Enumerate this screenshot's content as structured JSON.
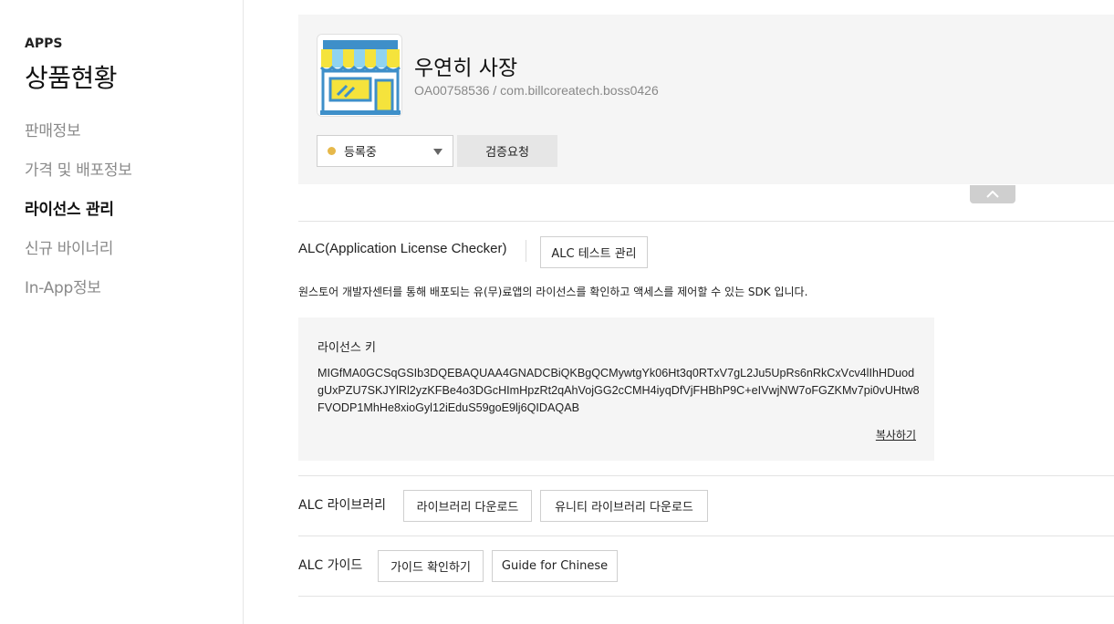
{
  "sidebar": {
    "section": "APPS",
    "title": "상품현황",
    "items": [
      {
        "label": "판매정보",
        "active": false
      },
      {
        "label": "가격 및 배포정보",
        "active": false
      },
      {
        "label": "라이선스 관리",
        "active": true
      },
      {
        "label": "신규 바이너리",
        "active": false
      },
      {
        "label": "In-App정보",
        "active": false
      }
    ]
  },
  "app": {
    "name": "우연히 사장",
    "meta": "OA00758536 / com.billcoreatech.boss0426",
    "icon": "storefront-icon",
    "status": {
      "value": "등록중",
      "dot_color": "#e6b84a"
    },
    "verify_label": "검증요청",
    "collapse_icon": "chevron-up-icon"
  },
  "alc": {
    "title": "ALC(Application License Checker)",
    "test_button": "ALC 테스트 관리",
    "description": "원스토어 개발자센터를 통해 배포되는 유(무)료앱의 라이선스를 확인하고 액세스를 제어할 수 있는 SDK 입니다.",
    "license": {
      "label": "라이선스 키",
      "key": "MIGfMA0GCSqGSIb3DQEBAQUAA4GNADCBiQKBgQCMywtgYk06Ht3q0RTxV7gL2Ju5UpRs6nRkCxVcv4lIhHDuodgUxPZU7SKJYlRl2yzKFBe4o3DGcHImHpzRt2qAhVojGG2cCMH4iyqDfVjFHBhP9C+eIVwjNW7oFGZKMv7pi0vUHtw8FVODP1MhHe8xioGyl12iEduS59goE9lj6QIDAQAB",
      "copy_label": "복사하기"
    }
  },
  "library": {
    "label": "ALC 라이브러리",
    "download_button": "라이브러리 다운로드",
    "unity_button": "유니티 라이브러리 다운로드"
  },
  "guide": {
    "label": "ALC 가이드",
    "check_button": "가이드 확인하기",
    "chinese_button": "Guide for Chinese"
  }
}
